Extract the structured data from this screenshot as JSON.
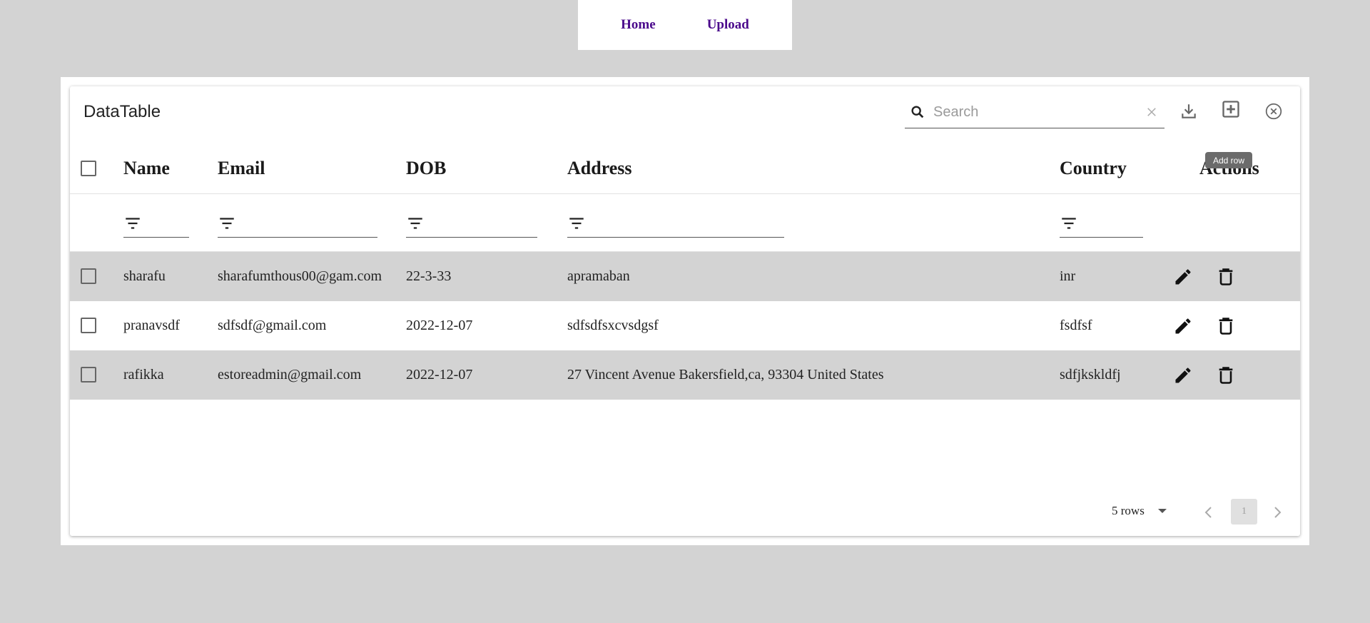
{
  "nav": {
    "links": [
      "Home",
      "Upload"
    ]
  },
  "table": {
    "title": "DataTable",
    "search": {
      "placeholder": "Search",
      "value": ""
    },
    "tooltip": "Add row",
    "columns": [
      "Name",
      "Email",
      "DOB",
      "Address",
      "Country",
      "Actions"
    ],
    "rows": [
      {
        "name": "sharafu",
        "email": "sharafumthous00@gam.com",
        "dob": "22-3-33",
        "address": "apramaban",
        "country": "inr"
      },
      {
        "name": "pranavsdf",
        "email": "sdfsdf@gmail.com",
        "dob": "2022-12-07",
        "address": "sdfsdfsxcvsdgsf",
        "country": "fsdfsf"
      },
      {
        "name": "rafikka",
        "email": "estoreadmin@gmail.com",
        "dob": "2022-12-07",
        "address": "27 Vincent Avenue Bakersfield,ca, 93304 United States",
        "country": "sdfjkskldfj"
      }
    ],
    "pagination": {
      "rows_per_page": "5 rows",
      "current_page": "1"
    }
  },
  "icons": {
    "search": "search-icon",
    "clear": "close-icon",
    "export": "download-icon",
    "add": "add-box-icon",
    "close_table": "circle-close-icon",
    "filter": "filter-icon",
    "edit": "edit-pencil-icon",
    "delete": "trash-icon"
  },
  "colors": {
    "nav_link": "#4b0a8c",
    "shaded_row": "#d3d3d3",
    "page_bg": "#d3d3d3"
  }
}
